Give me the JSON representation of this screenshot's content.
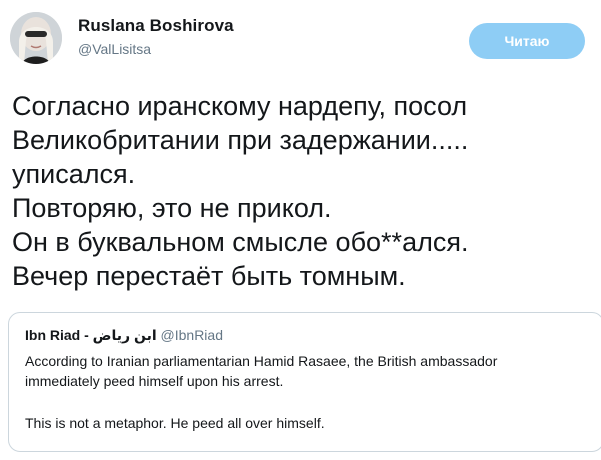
{
  "author": {
    "name": "Ruslana Boshirova",
    "handle": "@ValLisitsa"
  },
  "follow_button_label": "Читаю",
  "tweet_lines": [
    "Согласно иранскому нардепу, посол",
    "Великобритании при задержании.....",
    "уписался.",
    "Повторяю, это не прикол.",
    "Он в буквальном смысле обо**ался.",
    "Вечер перестаёт быть томным."
  ],
  "quoted_tweet": {
    "name": "Ibn Riad - ابن رياض",
    "handle": "@IbnRiad",
    "body_lines": [
      "According to Iranian parliamentarian Hamid Rasaee, the British ambassador",
      "immediately peed himself upon his arrest."
    ],
    "body_last": "This is not a metaphor. He peed all over himself."
  },
  "colors": {
    "follow_button_bg": "#8ecdf5",
    "handle_gray": "#657786",
    "border": "#ccd6dd"
  },
  "icons": {
    "avatar": "profile-photo"
  }
}
